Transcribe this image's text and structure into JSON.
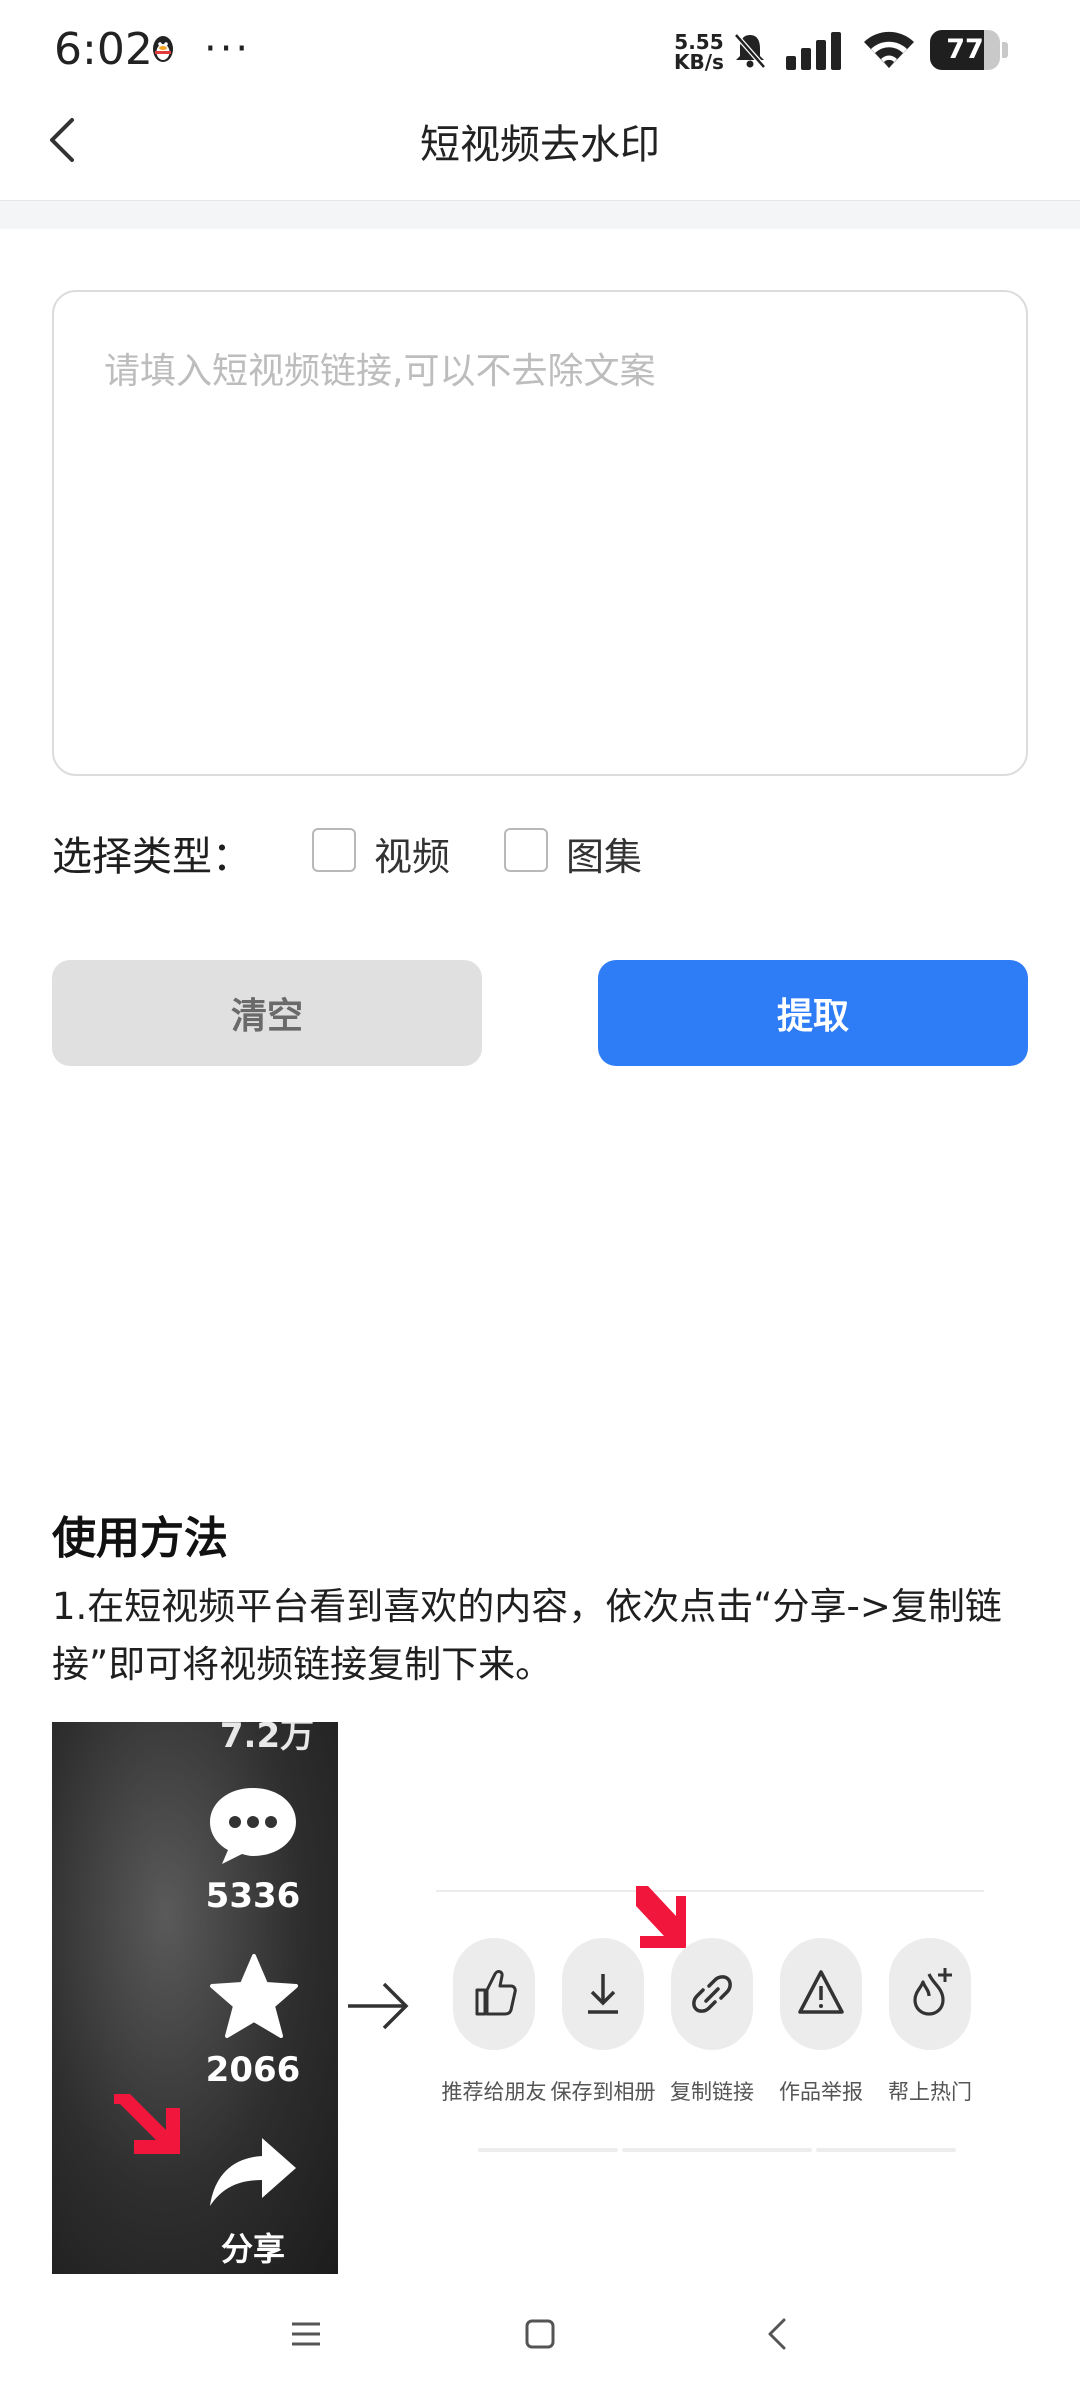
{
  "status_bar": {
    "time": "6:02",
    "more": "···",
    "net_speed_value": "5.55",
    "net_speed_unit": "KB/s",
    "battery_level": "77",
    "battery_fraction": 0.77
  },
  "header": {
    "title": "短视频去水印"
  },
  "form": {
    "link_placeholder": "请填入短视频链接,可以不去除文案",
    "link_value": "",
    "type_label": "选择类型：",
    "type_options": [
      {
        "label": "视频",
        "checked": false
      },
      {
        "label": "图集",
        "checked": false
      }
    ],
    "clear_button": "清空",
    "extract_button": "提取"
  },
  "usage": {
    "title": "使用方法",
    "step1": "1.在短视频平台看到喜欢的内容，依次点击“分享->复制链接”即可将视频链接复制下来。",
    "screenshot": {
      "likes_partial": "7.2万",
      "comments": "5336",
      "favorites": "2066",
      "share_label": "分享"
    },
    "share_panel": [
      {
        "label": "推荐给朋友",
        "icon": "thumbs-up-icon"
      },
      {
        "label": "保存到相册",
        "icon": "download-icon"
      },
      {
        "label": "复制链接",
        "icon": "link-icon"
      },
      {
        "label": "作品举报",
        "icon": "warning-icon"
      },
      {
        "label": "帮上热门",
        "icon": "flame-plus-icon"
      }
    ]
  },
  "colors": {
    "primary": "#2f7df6",
    "clear_bg": "#e0e0e0",
    "highlight_arrow": "#f0163c"
  }
}
